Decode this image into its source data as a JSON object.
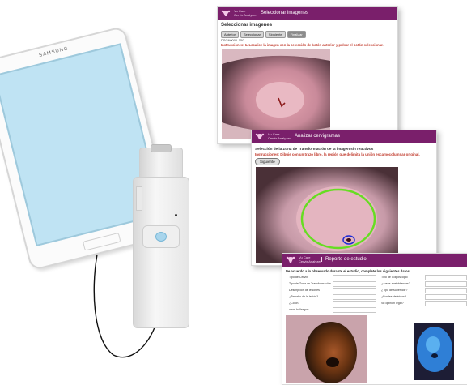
{
  "tablet": {
    "brand": "SAMSUNG"
  },
  "app": {
    "name_line1": "Vu Care",
    "name_line2": "Cervix Analyzer"
  },
  "screen1": {
    "header_title": "Seleccionar imagenes",
    "heading": "Seleccionar imagenes",
    "buttons": [
      "Anterior",
      "Seleccionar",
      "Siguiente",
      "Finalizar"
    ],
    "filename": "DSCN0001.JPG",
    "instruction": "Instrucciones: 1. Localice la imagen con la selección de botón anterior y pulsar el botón seleccionar."
  },
  "screen2": {
    "header_title": "Analizar cervigramas",
    "heading": "Selección de la Zona de Transformación de la imagen sin reactivos",
    "instruction": "Instrucciones: Dibuje con un trazo libre, la región que delimita la unión escamocolumnar original.",
    "button": "Siguiente"
  },
  "screen3": {
    "header_title": "Reporte de estudio",
    "form_title": "De acuerdo a lo observado durante el estudio, complete los siguientes datos.",
    "left_fields": [
      "Tipo de Cérvix",
      "Tipo de Zona de Transformación",
      "Descripción de lesiones",
      "¿Tamaño de la lesión?",
      "¿Color?",
      "otros hallazgos:"
    ],
    "right_fields": [
      "Tipo de Colposcopio",
      "¿Áreas acetoblancas?",
      "¿Tipo de superficie?",
      "¿Bordes definidos?",
      "Su opinión legal?"
    ]
  },
  "colors": {
    "header": "#7a1f6b",
    "instruction": "#c0392b",
    "roi_outline": "#66dd22",
    "tablet_screen": "#bfe3f3"
  },
  "icons": [
    "uterus-logo-icon"
  ]
}
